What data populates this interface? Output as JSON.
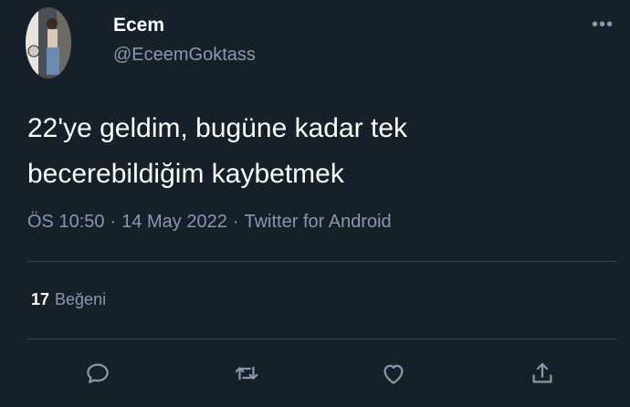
{
  "author": {
    "name": "Ecem",
    "handle": "@EceemGoktass"
  },
  "tweet": {
    "text_line1": "22'ye geldim, bugüne kadar tek",
    "text_line2": "becerebildiğim kaybetmek",
    "time": "ÖS 10:50",
    "date": "14 May 2022",
    "source": "Twitter for Android",
    "separator": "·"
  },
  "stats": {
    "likes_count": "17",
    "likes_label": "Beğeni"
  },
  "more_label": "•••",
  "icons": {
    "more": "more-icon",
    "reply": "reply-icon",
    "retweet": "retweet-icon",
    "like": "like-icon",
    "share": "share-icon"
  },
  "colors": {
    "background": "#15202b",
    "text_primary": "#ffffff",
    "text_secondary": "#8b98a5",
    "divider": "#38444d"
  }
}
